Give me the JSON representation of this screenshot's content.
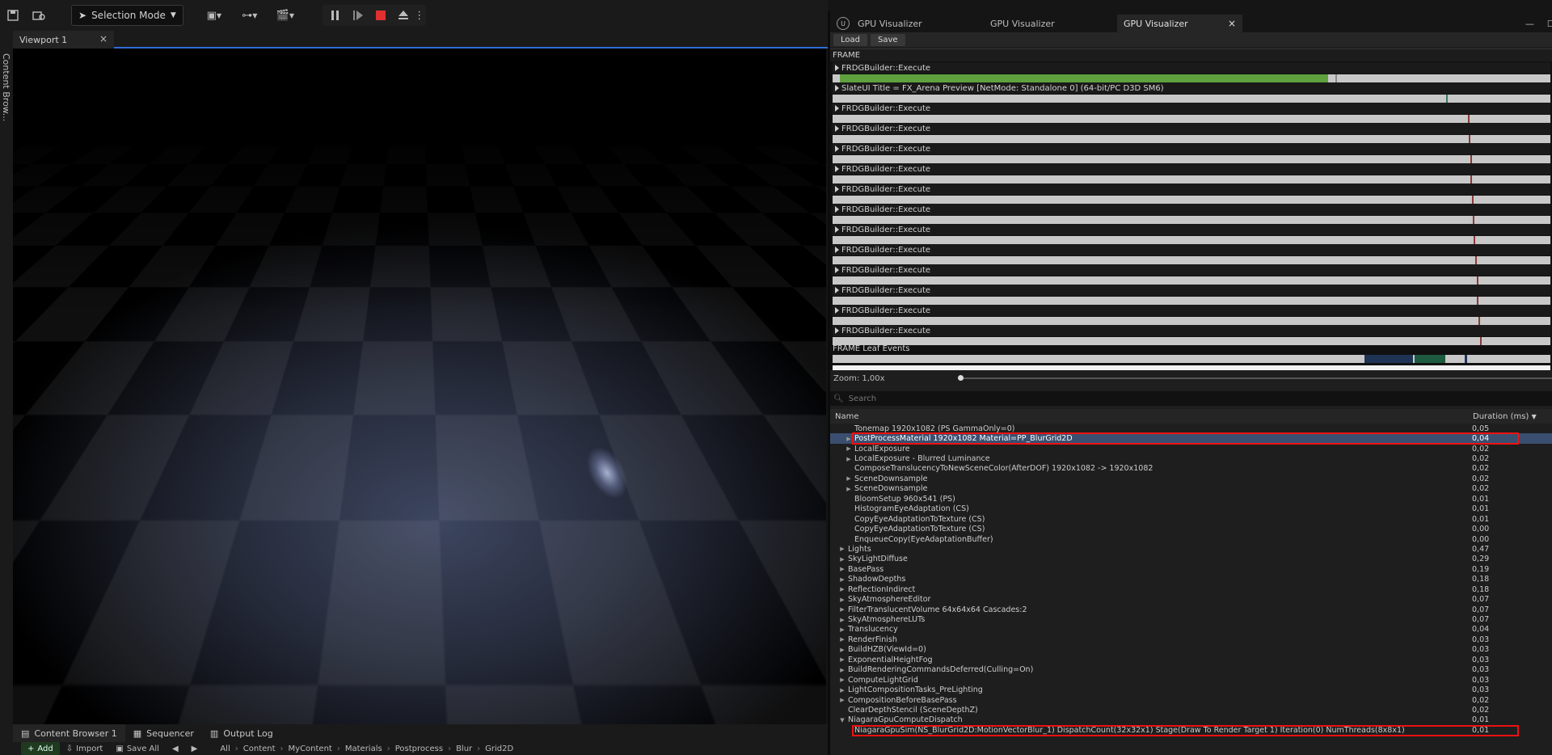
{
  "toolbar": {
    "selection_mode": "Selection Mode"
  },
  "left_strip": {
    "label": "Content Brow..."
  },
  "viewport": {
    "tab_label": "Viewport 1"
  },
  "bottom_tabs": [
    {
      "label": "Content Browser 1"
    },
    {
      "label": "Sequencer"
    },
    {
      "label": "Output Log"
    }
  ],
  "content_bar": {
    "add": "Add",
    "import": "Import",
    "save_all": "Save All",
    "path": [
      "All",
      "Content",
      "MyContent",
      "Materials",
      "Postprocess",
      "Blur",
      "Grid2D"
    ]
  },
  "gpu": {
    "tabs": [
      "GPU Visualizer",
      "GPU Visualizer",
      "GPU Visualizer"
    ],
    "load": "Load",
    "save": "Save",
    "frame_label": "FRAME",
    "events": [
      {
        "label": "FRDGBuilder::Execute",
        "green_fraction": 0.69,
        "mark": 0.7
      },
      {
        "label": "SlateUI Title = FX_Arena Preview [NetMode: Standalone 0]  (64-bit/PC D3D SM6)",
        "mark": 0.855
      },
      {
        "label": "FRDGBuilder::Execute",
        "mark": 0.885
      },
      {
        "label": "FRDGBuilder::Execute",
        "mark": 0.886
      },
      {
        "label": "FRDGBuilder::Execute",
        "mark": 0.888
      },
      {
        "label": "FRDGBuilder::Execute",
        "mark": 0.889
      },
      {
        "label": "FRDGBuilder::Execute",
        "mark": 0.891
      },
      {
        "label": "FRDGBuilder::Execute",
        "mark": 0.892
      },
      {
        "label": "FRDGBuilder::Execute",
        "mark": 0.893
      },
      {
        "label": "FRDGBuilder::Execute",
        "mark": 0.895
      },
      {
        "label": "FRDGBuilder::Execute",
        "mark": 0.897
      },
      {
        "label": "FRDGBuilder::Execute",
        "mark": 0.898
      },
      {
        "label": "FRDGBuilder::Execute",
        "mark": 0.9
      },
      {
        "label": "FRDGBuilder::Execute",
        "mark": 0.902
      }
    ],
    "leaf_label": "FRAME Leaf Events",
    "zoom": "Zoom: 1,00x",
    "search_placeholder": "Search",
    "col_name": "Name",
    "col_duration": "Duration (ms)",
    "rows": [
      {
        "indent": 2,
        "arrow": false,
        "name": "Tonemap 1920x1082 (PS GammaOnly=0)",
        "dur": "0,05"
      },
      {
        "indent": 2,
        "arrow": true,
        "name": "PostProcessMaterial 1920x1082 Material=PP_BlurGrid2D",
        "dur": "0,04",
        "selected": true,
        "highlight": true
      },
      {
        "indent": 2,
        "arrow": true,
        "name": "LocalExposure",
        "dur": "0,02"
      },
      {
        "indent": 2,
        "arrow": true,
        "name": "LocalExposure - Blurred Luminance",
        "dur": "0,02"
      },
      {
        "indent": 2,
        "arrow": false,
        "name": "ComposeTranslucencyToNewSceneColor(AfterDOF) 1920x1082 -> 1920x1082",
        "dur": "0,02"
      },
      {
        "indent": 2,
        "arrow": true,
        "name": "SceneDownsample",
        "dur": "0,02"
      },
      {
        "indent": 2,
        "arrow": true,
        "name": "SceneDownsample",
        "dur": "0,02"
      },
      {
        "indent": 2,
        "arrow": false,
        "name": "BloomSetup 960x541 (PS)",
        "dur": "0,01"
      },
      {
        "indent": 2,
        "arrow": false,
        "name": "HistogramEyeAdaptation (CS)",
        "dur": "0,01"
      },
      {
        "indent": 2,
        "arrow": false,
        "name": "CopyEyeAdaptationToTexture (CS)",
        "dur": "0,01"
      },
      {
        "indent": 2,
        "arrow": false,
        "name": "CopyEyeAdaptationToTexture (CS)",
        "dur": "0,00"
      },
      {
        "indent": 2,
        "arrow": false,
        "name": "EnqueueCopy(EyeAdaptationBuffer)",
        "dur": "0,00"
      },
      {
        "indent": 1,
        "arrow": true,
        "name": "Lights",
        "dur": "0,47"
      },
      {
        "indent": 1,
        "arrow": true,
        "name": "SkyLightDiffuse",
        "dur": "0,29"
      },
      {
        "indent": 1,
        "arrow": true,
        "name": "BasePass",
        "dur": "0,19"
      },
      {
        "indent": 1,
        "arrow": true,
        "name": "ShadowDepths",
        "dur": "0,18"
      },
      {
        "indent": 1,
        "arrow": true,
        "name": "ReflectionIndirect",
        "dur": "0,18"
      },
      {
        "indent": 1,
        "arrow": true,
        "name": "SkyAtmosphereEditor",
        "dur": "0,07"
      },
      {
        "indent": 1,
        "arrow": true,
        "name": "FilterTranslucentVolume 64x64x64 Cascades:2",
        "dur": "0,07"
      },
      {
        "indent": 1,
        "arrow": true,
        "name": "SkyAtmosphereLUTs",
        "dur": "0,07"
      },
      {
        "indent": 1,
        "arrow": true,
        "name": "Translucency",
        "dur": "0,04"
      },
      {
        "indent": 1,
        "arrow": true,
        "name": "RenderFinish",
        "dur": "0,03"
      },
      {
        "indent": 1,
        "arrow": true,
        "name": "BuildHZB(ViewId=0)",
        "dur": "0,03"
      },
      {
        "indent": 1,
        "arrow": true,
        "name": "ExponentialHeightFog",
        "dur": "0,03"
      },
      {
        "indent": 1,
        "arrow": true,
        "name": "BuildRenderingCommandsDeferred(Culling=On)",
        "dur": "0,03"
      },
      {
        "indent": 1,
        "arrow": true,
        "name": "ComputeLightGrid",
        "dur": "0,03"
      },
      {
        "indent": 1,
        "arrow": true,
        "name": "LightCompositionTasks_PreLighting",
        "dur": "0,03"
      },
      {
        "indent": 1,
        "arrow": true,
        "name": "CompositionBeforeBasePass",
        "dur": "0,02"
      },
      {
        "indent": 1,
        "arrow": false,
        "name": "ClearDepthStencil (SceneDepthZ)",
        "dur": "0,02"
      },
      {
        "indent": 1,
        "arrow": true,
        "open": true,
        "name": "NiagaraGpuComputeDispatch",
        "dur": "0,01"
      },
      {
        "indent": 2,
        "arrow": false,
        "name": "NiagaraGpuSim(NS_BlurGrid2D:MotionVectorBlur_1) DispatchCount(32x32x1) Stage(Draw To Render Target 1) Iteration(0) NumThreads(8x8x1)",
        "dur": "0,01",
        "highlight": true
      }
    ]
  }
}
